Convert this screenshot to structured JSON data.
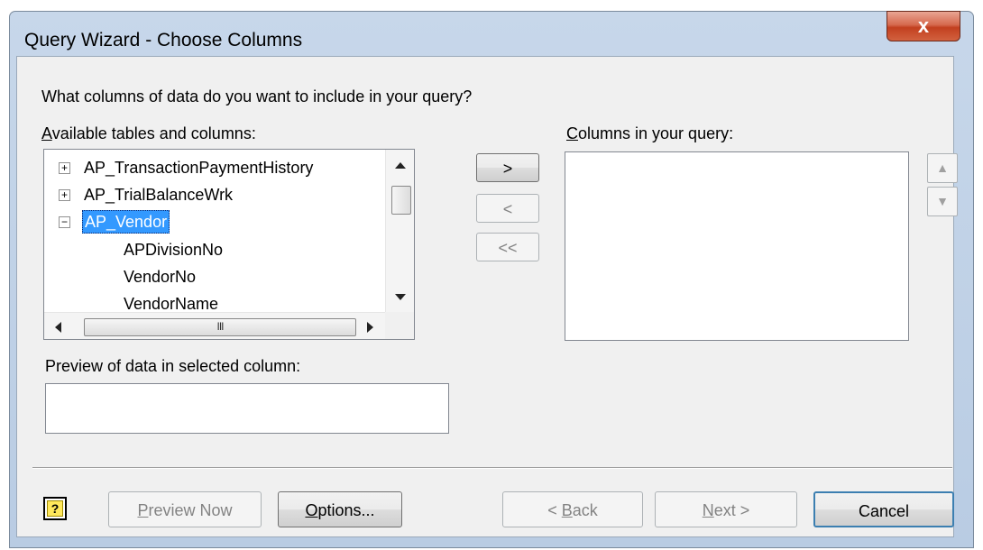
{
  "window": {
    "title": "Query Wizard - Choose Columns",
    "close_glyph": "x"
  },
  "prompt": "What columns of data do you want to include in your query?",
  "available": {
    "label_underlined": "A",
    "label_rest": "vailable tables and columns:",
    "items": [
      {
        "expander": "+",
        "label": "AP_TransactionPaymentHistory"
      },
      {
        "expander": "+",
        "label": "AP_TrialBalanceWrk"
      },
      {
        "expander": "−",
        "label": "AP_Vendor",
        "selected": true
      },
      {
        "label": "APDivisionNo"
      },
      {
        "label": "VendorNo"
      },
      {
        "label": "VendorName"
      }
    ],
    "hscroll_grip": "III"
  },
  "move_buttons": {
    "add": ">",
    "remove": "<",
    "remove_all": "<<"
  },
  "query_columns": {
    "label_underlined": "C",
    "label_rest": "olumns in your query:"
  },
  "preview": {
    "label": "Preview of data in selected column:",
    "value": ""
  },
  "footer": {
    "help_glyph": "?",
    "preview_now_u": "P",
    "preview_now_rest": "review Now",
    "options_u": "O",
    "options_rest": "ptions...",
    "back_pre": "< ",
    "back_u": "B",
    "back_rest": "ack",
    "next_u": "N",
    "next_rest": "ext >",
    "cancel": "Cancel"
  },
  "colors": {
    "selection": "#3399ff",
    "titlebar": "#c7d7ea",
    "close": "#c2401f"
  }
}
